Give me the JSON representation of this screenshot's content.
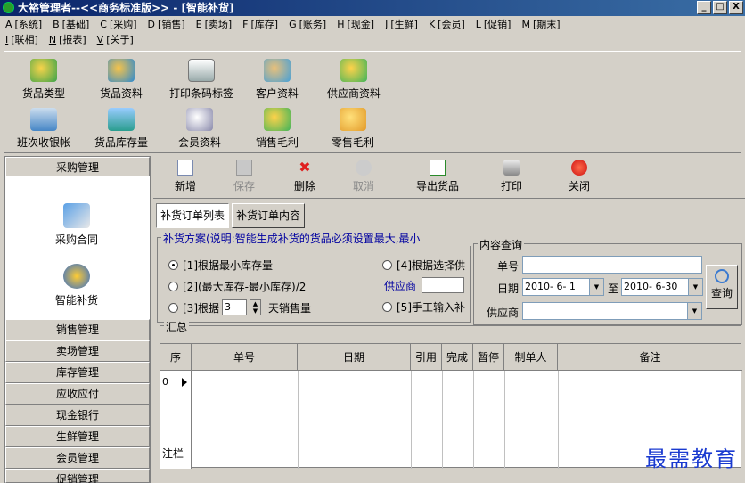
{
  "window": {
    "title": "大裕管理者--<<商务标准版>> - [智能补货]",
    "minimize": "_",
    "maximize": "□",
    "close": "X"
  },
  "menu": {
    "row1": [
      {
        "key": "A",
        "label": "[系统]"
      },
      {
        "key": "B",
        "label": "[基础]"
      },
      {
        "key": "C",
        "label": "[采购]"
      },
      {
        "key": "D",
        "label": "[销售]"
      },
      {
        "key": "E",
        "label": "[卖场]"
      },
      {
        "key": "F",
        "label": "[库存]"
      },
      {
        "key": "G",
        "label": "[账务]"
      },
      {
        "key": "H",
        "label": "[现金]"
      },
      {
        "key": "J",
        "label": "[生鲜]"
      },
      {
        "key": "K",
        "label": "[会员]"
      },
      {
        "key": "L",
        "label": "[促销]"
      },
      {
        "key": "M",
        "label": "[期末]"
      }
    ],
    "row2": [
      {
        "key": "I",
        "label": "[联相]"
      },
      {
        "key": "N",
        "label": "[报表]"
      },
      {
        "key": "V",
        "label": "[关于]"
      }
    ]
  },
  "main_buttons": [
    {
      "label": "货品类型",
      "icon": "goods-type-icon"
    },
    {
      "label": "货品资料",
      "icon": "goods-data-icon"
    },
    {
      "label": "打印条码标签",
      "icon": "barcode-printer-icon"
    },
    {
      "label": "客户资料",
      "icon": "customer-icon"
    },
    {
      "label": "供应商资料",
      "icon": "supplier-icon"
    },
    {
      "label": "班次收银帐",
      "icon": "cashier-shift-icon"
    },
    {
      "label": "货品库存量",
      "icon": "stock-icon"
    },
    {
      "label": "会员资料",
      "icon": "member-icon"
    },
    {
      "label": "销售毛利",
      "icon": "sales-margin-icon"
    },
    {
      "label": "零售毛利",
      "icon": "retail-margin-icon"
    }
  ],
  "left_panel": {
    "header": "采购管理",
    "entries": [
      {
        "label": "采购合同",
        "icon": "contract-icon"
      },
      {
        "label": "智能补货",
        "icon": "smart-restock-icon"
      }
    ],
    "groups": [
      "销售管理",
      "卖场管理",
      "库存管理",
      "应收应付",
      "现金银行",
      "生鲜管理",
      "会员管理",
      "促销管理"
    ]
  },
  "toolbar": {
    "new": "新增",
    "save": "保存",
    "delete": "删除",
    "cancel": "取消",
    "export": "导出货品",
    "print": "打印",
    "close": "关闭"
  },
  "tabs": {
    "list": "补货订单列表",
    "content": "补货订单内容"
  },
  "plan": {
    "legend": "补货方案(说明:智能生成补货的货品必须设置最大,最小",
    "opt1": "[1]根据最小库存量",
    "opt2": "[2](最大库存-最小库存)/2",
    "opt3_prefix": "[3]根据",
    "opt3_days": "3",
    "opt3_suffix": "天销售量",
    "opt4": "[4]根据选择供",
    "supplier_label": "供应商",
    "opt5": "[5]手工输入补"
  },
  "query": {
    "legend": "内容查询",
    "order_no_label": "单号",
    "date_label": "日期",
    "date_from": "2010- 6- 1",
    "to_label": "至",
    "date_to": "2010- 6-30",
    "supplier_label": "供应商",
    "button": "查询"
  },
  "summary": {
    "legend": "汇总"
  },
  "grid": {
    "columns": [
      "序",
      "单号",
      "日期",
      "引用",
      "完成",
      "暂停",
      "制单人",
      "备注"
    ],
    "row_num": "0",
    "footer": "注栏"
  },
  "watermark": "最需教育"
}
